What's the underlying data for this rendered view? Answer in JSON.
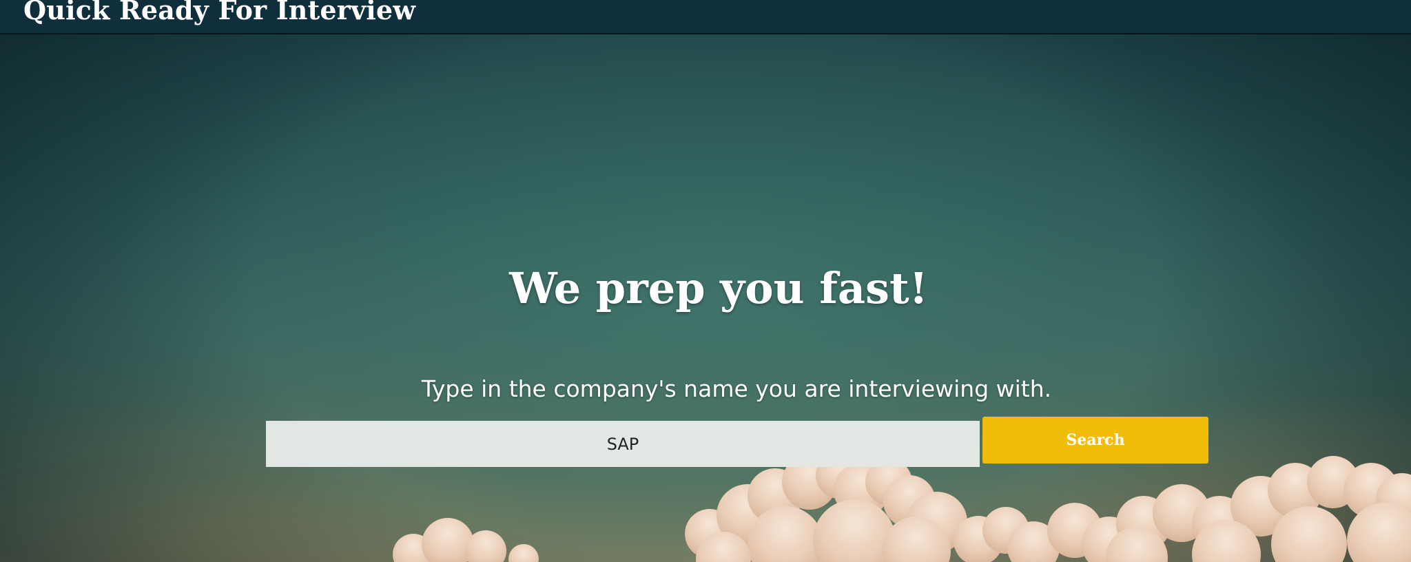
{
  "header": {
    "brand": "Quick Ready For Interview"
  },
  "hero": {
    "headline": "We prep you fast!",
    "subhead": "Type in the company's name you are interviewing with."
  },
  "search": {
    "value": "SAP",
    "button_label": "Search"
  },
  "colors": {
    "topbar": "#0f2f3d",
    "search_button": "#f0bd0a",
    "input_background": "#e2e7e4"
  }
}
